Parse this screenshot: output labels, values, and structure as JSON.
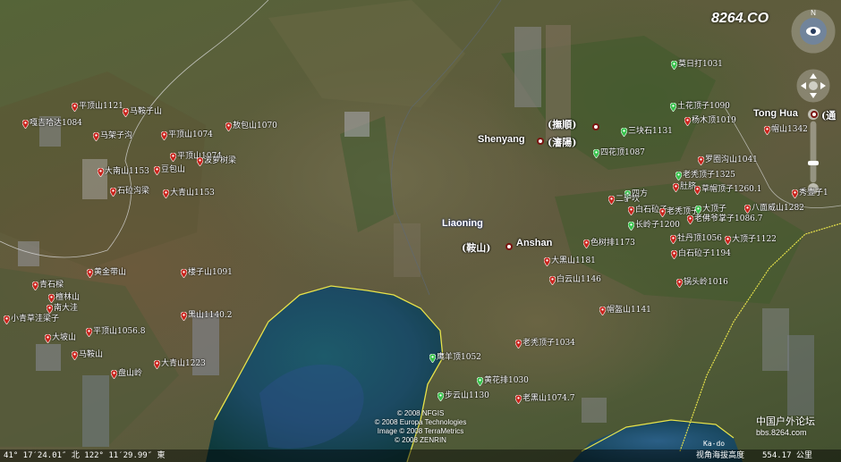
{
  "watermark": {
    "site_logo": "8264.CO",
    "forum_line1": "中国户外论坛",
    "forum_line2": "bbs.8264.com"
  },
  "regions": {
    "province": "Liaoning"
  },
  "cities": [
    {
      "en": "Shenyang",
      "cn": "(瀋陽)",
      "cn2": "(撫順)"
    },
    {
      "en": "Anshan",
      "cn": "(鞍山)"
    },
    {
      "en": "Tong Hua",
      "cn": "(通"
    }
  ],
  "map_labels": [
    "平顶山1121",
    "马鞍子山",
    "嘎吉哈达1084",
    "马架子沟",
    "平顶山1074",
    "敖包山1070",
    "平顶山1074",
    "波萝树梁",
    "大南山1153",
    "豆包山",
    "石砬沟梁",
    "大青山1153",
    "楼子山1091",
    "黄金带山",
    "青石樑",
    "檀林山",
    "南大洼",
    "小青草洼梁子",
    "大坡山",
    "平顶山1056.8",
    "马鞍山",
    "黑山1140.2",
    "大青山1223",
    "盘山岭",
    "莫日打1031",
    "土花顶子1090",
    "杨木顶1019",
    "三块石1131",
    "四花顶1087",
    "罗圈沟山1041",
    "老秃顶子1325",
    "草帽顶子1260.1",
    "肚脐",
    "四方",
    "白石砬子",
    "老秃顶子",
    "大顶子",
    "八面威山1282",
    "老佛爷掌子1086.7",
    "长岭子1200",
    "二驴坎",
    "色树排1173",
    "牡丹顶1056",
    "大顶子1122",
    "白石砬子1194",
    "大黑山1181",
    "白云山1146",
    "锅头岭1016",
    "帽盔山1141",
    "老秃顶子1034",
    "鹰羊顶1052",
    "黄花排1030",
    "步云山1130",
    "老黑山1074.7",
    "帽山1342",
    "秀壶子1"
  ],
  "credits": [
    "© 2008 NFGIS",
    "© 2008 Europa Technologies",
    "Image © 2008 TerraMetrics",
    "© 2008 ZENRIN"
  ],
  "statusbar": {
    "coords": "41° 17′24.01″ 北  122° 11′29.99″ 東",
    "location": "Ka-do",
    "eye_alt_label": "视角海拔高度",
    "eye_alt": "554.17 公里"
  },
  "colors": {
    "pin": "#c8231b",
    "green_marker": "#36c24a",
    "border": "#e7e24a"
  }
}
